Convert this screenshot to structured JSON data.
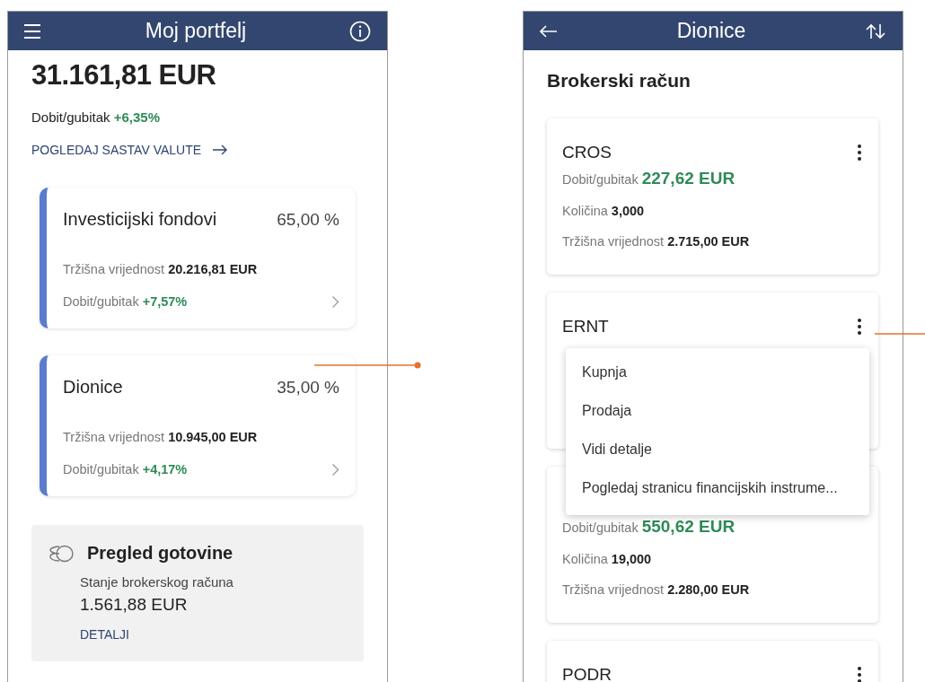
{
  "left_screen": {
    "header": {
      "title": "Moj portfelj"
    },
    "total": "31.161,81 EUR",
    "profit": {
      "label": "Dobit/gubitak",
      "value": "+6,35%"
    },
    "link": "POGLEDAJ SASTAV VALUTE",
    "categories": [
      {
        "name": "Investicijski fondovi",
        "percent": "65,00 %",
        "rows": [
          {
            "label": "Tržišna vrijednost",
            "value": "20.216,81 EUR",
            "positive": false
          },
          {
            "label": "Dobit/gubitak",
            "value": "+7,57%",
            "positive": true
          }
        ]
      },
      {
        "name": "Dionice",
        "percent": "35,00 %",
        "rows": [
          {
            "label": "Tržišna vrijednost",
            "value": "10.945,00 EUR",
            "positive": false
          },
          {
            "label": "Dobit/gubitak",
            "value": "+4,17%",
            "positive": true
          }
        ]
      }
    ],
    "cash": {
      "title": "Pregled gotovine",
      "label": "Stanje brokerskog računa",
      "amount": "1.561,88 EUR",
      "link": "DETALJI"
    }
  },
  "right_screen": {
    "header": {
      "title": "Dionice"
    },
    "section_title": "Brokerski račun",
    "cards": [
      {
        "name": "CROS",
        "menu_open": false,
        "rows": [
          {
            "label": "Dobit/gubitak",
            "value": "227,62 EUR",
            "positive": true
          },
          {
            "label": "Količina",
            "value": "3,000",
            "positive": false
          },
          {
            "label": "Tržišna vrijednost",
            "value": "2.715,00 EUR",
            "positive": false
          }
        ]
      },
      {
        "name": "ERNT",
        "menu_open": true
      },
      {
        "menu_open": false,
        "rows": [
          {
            "label": "Dobit/gubitak",
            "value": "550,62 EUR",
            "positive": true
          },
          {
            "label": "Količina",
            "value": "19,000",
            "positive": false
          },
          {
            "label": "Tržišna vrijednost",
            "value": "2.280,00 EUR",
            "positive": false
          }
        ]
      },
      {
        "name": "PODR",
        "menu_open": false
      }
    ],
    "menu": {
      "items": [
        "Kupnja",
        "Prodaja",
        "Vidi detalje",
        "Pogledaj stranicu financijskih instrume..."
      ]
    }
  }
}
